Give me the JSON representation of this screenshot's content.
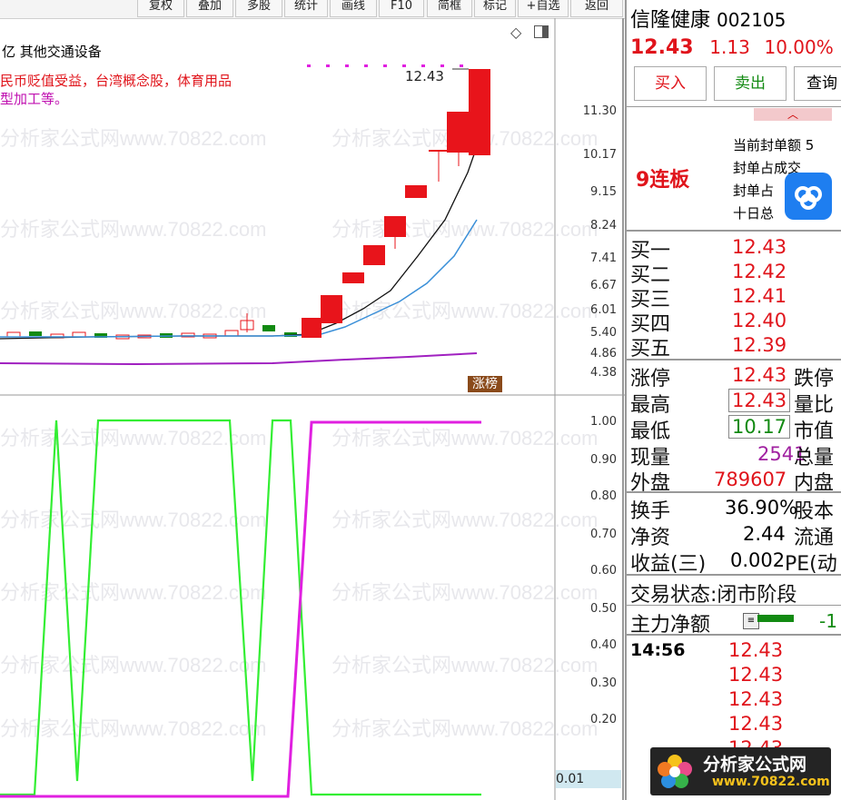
{
  "toolbar": {
    "buttons": [
      "复权",
      "叠加",
      "多股",
      "统计",
      "画线",
      "F10",
      "简框",
      "标记",
      "+自选",
      "返回"
    ]
  },
  "chart": {
    "header_text": "亿 其他交通设备",
    "desc_line1": "民币贬值受益，台湾概念股，体育用品",
    "desc_line2": "型加工等。",
    "high_label": "12.43",
    "badge": "涨榜",
    "upper_axis": [
      "11.30",
      "10.17",
      "9.15",
      "8.24",
      "7.41",
      "6.67",
      "6.01",
      "5.40",
      "4.86",
      "4.38"
    ],
    "lower_axis": [
      "1.00",
      "0.90",
      "0.80",
      "0.70",
      "0.60",
      "0.50",
      "0.40",
      "0.30",
      "0.20"
    ],
    "lower_value": "0.01",
    "watermark": "分析家公式网www.70822.com",
    "colors": {
      "up": "#e8141b",
      "down": "#128a12",
      "ma_black": "#111111",
      "ma_blue": "#3a8fd8",
      "purple": "#a020c0",
      "green_line": "#33ee33",
      "magenta_line": "#e020e0"
    }
  },
  "quote": {
    "name": "信隆健康",
    "code": "002105",
    "price": "12.43",
    "change": "1.13",
    "pct": "10.00%",
    "buy_label": "买入",
    "sell_label": "卖出",
    "query_label": "查询",
    "board": "9连板",
    "seal_items": [
      "当前封单额",
      "封单占成交",
      "封单占",
      "十日总"
    ],
    "seal_value": "5",
    "bids": [
      {
        "label": "买一",
        "value": "12.43"
      },
      {
        "label": "买二",
        "value": "12.42"
      },
      {
        "label": "买三",
        "value": "12.41"
      },
      {
        "label": "买四",
        "value": "12.40"
      },
      {
        "label": "买五",
        "value": "12.39"
      }
    ],
    "stats": [
      {
        "label": "涨停",
        "value": "12.43",
        "right": "跌停"
      },
      {
        "label": "最高",
        "value": "12.43",
        "right": "量比"
      },
      {
        "label": "最低",
        "value": "10.17",
        "right": "市值"
      },
      {
        "label": "现量",
        "value": "2541",
        "right": "总量"
      },
      {
        "label": "外盘",
        "value": "789607",
        "right": "内盘"
      }
    ],
    "fundamentals": [
      {
        "label": "换手",
        "value": "36.90%",
        "right": "股本"
      },
      {
        "label": "净资",
        "value": "2.44",
        "right": "流通"
      },
      {
        "label": "收益(三)",
        "value": "0.002",
        "right": "PE(动"
      }
    ],
    "status_label": "交易状态:",
    "status_value": "闭市阶段",
    "main_flow_label": "主力净额",
    "main_flow_value": "-1",
    "ticks_time": "14:56",
    "ticks": [
      "12.43",
      "12.43",
      "12.43",
      "12.43",
      "12.43"
    ]
  },
  "logo": {
    "title": "分析家公式网",
    "url": "www.70822.com"
  }
}
